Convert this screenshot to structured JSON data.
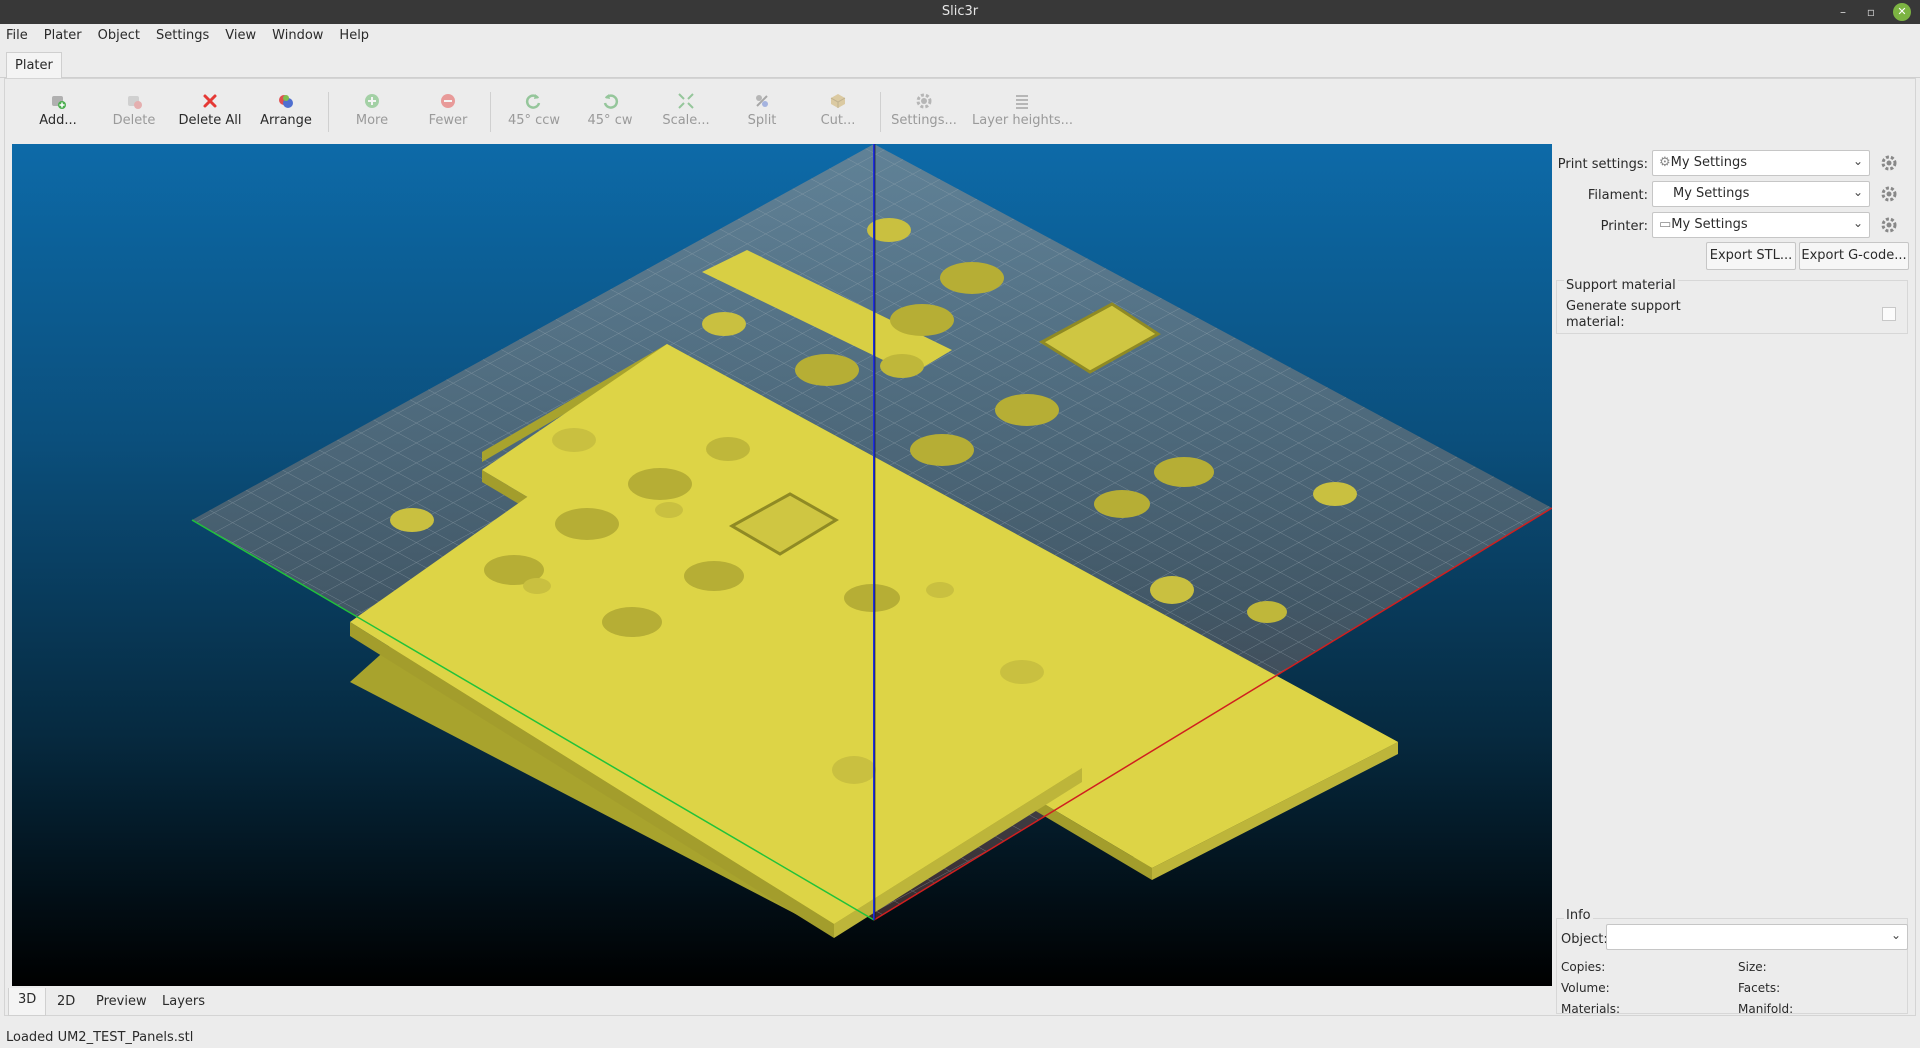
{
  "window": {
    "title": "Slic3r"
  },
  "menu": [
    "File",
    "Plater",
    "Object",
    "Settings",
    "View",
    "Window",
    "Help"
  ],
  "tabs": {
    "plater": "Plater"
  },
  "toolbar": {
    "add": "Add...",
    "delete": "Delete",
    "delete_all": "Delete All",
    "arrange": "Arrange",
    "more": "More",
    "fewer": "Fewer",
    "rotate_ccw": "45° ccw",
    "rotate_cw": "45° cw",
    "scale": "Scale...",
    "split": "Split",
    "cut": "Cut...",
    "settings": "Settings...",
    "layer_heights": "Layer heights..."
  },
  "view_tabs": [
    "3D",
    "2D",
    "Preview",
    "Layers"
  ],
  "active_view_tab": "3D",
  "side": {
    "print_settings_label": "Print settings:",
    "print_settings_value": "My Settings",
    "filament_label": "Filament:",
    "filament_value": "My Settings",
    "printer_label": "Printer:",
    "printer_value": "My Settings",
    "export_stl": "Export STL...",
    "export_gcode": "Export G-code...",
    "support_group": "Support material",
    "generate_support": "Generate support material:",
    "generate_support_checked": false,
    "info_group": "Info",
    "object_label": "Object:",
    "object_value": "",
    "copies_label": "Copies:",
    "size_label": "Size:",
    "volume_label": "Volume:",
    "facets_label": "Facets:",
    "materials_label": "Materials:",
    "manifold_label": "Manifold:"
  },
  "status": "Loaded UM2_TEST_Panels.stl",
  "colors": {
    "bed_grid": "#5a6e7a",
    "part": "#e0d64a",
    "x_axis": "#d01f1f",
    "y_axis": "#21c23a",
    "z_axis": "#1f2fe0",
    "delete_all_icon": "#e53935"
  }
}
